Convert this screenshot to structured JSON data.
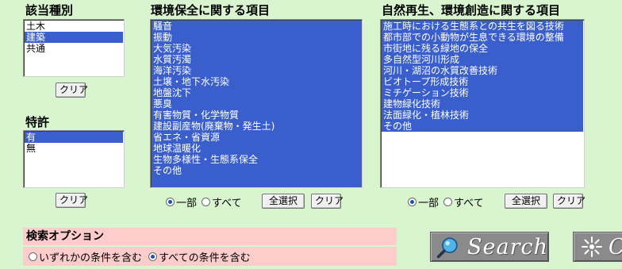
{
  "category": {
    "heading": "該当種別",
    "options": [
      {
        "label": "土木",
        "selected": false
      },
      {
        "label": "建築",
        "selected": true
      },
      {
        "label": "共通",
        "selected": false
      }
    ],
    "clear_label": "クリア"
  },
  "patent": {
    "heading": "特許",
    "options": [
      {
        "label": "有",
        "selected": true
      },
      {
        "label": "無",
        "selected": false
      }
    ],
    "clear_label": "クリア"
  },
  "environment": {
    "heading": "環境保全に関する項目",
    "options": [
      "騒音",
      "振動",
      "大気汚染",
      "水質汚濁",
      "海洋汚染",
      "土壌・地下水汚染",
      "地盤沈下",
      "悪臭",
      "有害物質・化学物質",
      "建設副産物(廃棄物・発生土)",
      "省エネ・省資源",
      "地球温暖化",
      "生物多様性・生態系保全",
      "その他"
    ],
    "match_partial": "一部",
    "match_all": "すべて",
    "match_selected": "partial",
    "select_all_label": "全選択",
    "clear_label": "クリア"
  },
  "nature": {
    "heading": "自然再生、環境創造に関する項目",
    "options": [
      "施工時における生態系との共生を図る技術",
      "都市部での小動物が生息できる環境の整備",
      "市街地に残る緑地の保全",
      "多自然型河川形成",
      "河川・湖沼の水質改善技術",
      "ビオトープ形成技術",
      "ミチゲーション技術",
      "建物緑化技術",
      "法面緑化・植林技術",
      "その他"
    ],
    "match_partial": "一部",
    "match_all": "すべて",
    "match_selected": "partial",
    "select_all_label": "全選択",
    "clear_label": "クリア"
  },
  "search_options": {
    "heading": "検索オプション",
    "any_label": "いずれかの条件を含む",
    "all_label": "すべての条件を含む",
    "selected": "all"
  },
  "search_button": {
    "label": "Search",
    "icon": "magnifier-icon"
  },
  "reset_button": {
    "label": "C",
    "icon": "sparkle-icon"
  }
}
